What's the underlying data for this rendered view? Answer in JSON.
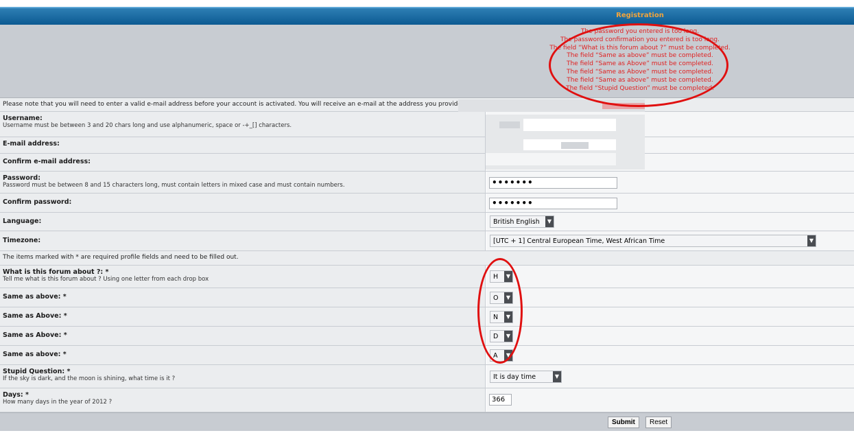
{
  "header": {
    "title": "Registration"
  },
  "errors": [
    "The password you entered is too long.",
    "The password confirmation you entered is too long.",
    "The field “What is this forum about ?” must be completed.",
    "The field “Same as above” must be completed.",
    "The field “Same as Above” must be completed.",
    "The field “Same as Above” must be completed.",
    "The field “Same as above” must be completed.",
    "The field “Stupid Question” must be completed."
  ],
  "notice": "Please note that you will need to enter a valid e-mail address before your account is activated. You will receive an e-mail at the address you provide that contains an account activation link.",
  "username": {
    "label": "Username:",
    "explain": "Username must be between 3 and 20 chars long and use alphanumeric, space or -+_[] characters."
  },
  "email": {
    "label": "E-mail address:"
  },
  "email_confirm": {
    "label": "Confirm e-mail address:"
  },
  "password": {
    "label": "Password:",
    "explain": "Password must be between 8 and 15 characters long, must contain letters in mixed case and must contain numbers.",
    "value": "•••••••"
  },
  "password_confirm": {
    "label": "Confirm password:",
    "value": "•••••••"
  },
  "language": {
    "label": "Language:",
    "selected": "British English"
  },
  "timezone": {
    "label": "Timezone:",
    "selected": "[UTC + 1] Central European Time, West African Time"
  },
  "profile_note": "The items marked with * are required profile fields and need to be filled out.",
  "profile_fields": [
    {
      "label": "What is this forum about ?: *",
      "explain": "Tell me what is this forum about ? Using one letter from each drop box",
      "selected": "H"
    },
    {
      "label": "Same as above: *",
      "selected": "O"
    },
    {
      "label": "Same as Above: *",
      "selected": "N"
    },
    {
      "label": "Same as Above: *",
      "selected": "D"
    },
    {
      "label": "Same as above: *",
      "selected": "A"
    }
  ],
  "stupid_question": {
    "label": "Stupid Question: *",
    "explain": "If the sky is dark, and the moon is shining, what time is it ?",
    "selected": "It is day time"
  },
  "days": {
    "label": "Days: *",
    "explain": "How many days in the year of 2012 ?",
    "value": "366"
  },
  "buttons": {
    "submit": "Submit",
    "reset": "Reset"
  },
  "colors": {
    "header_bg": "#1a6aa3",
    "header_title": "#f2a43b",
    "error_text": "#e02020",
    "annotation": "#e01010"
  }
}
